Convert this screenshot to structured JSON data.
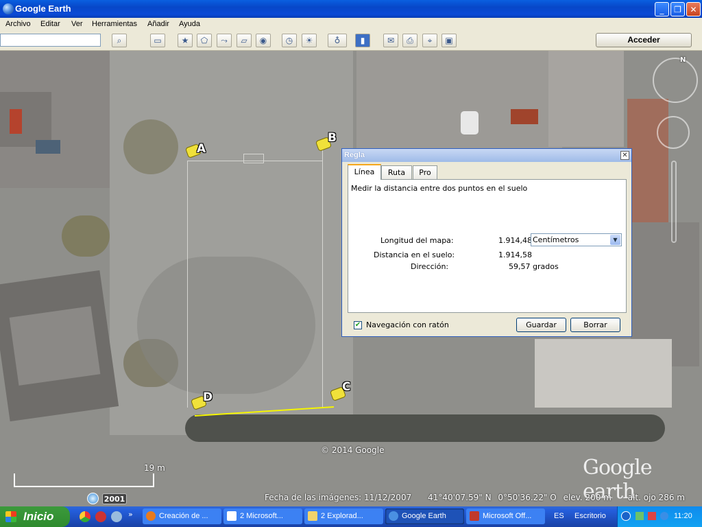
{
  "window": {
    "title": "Google Earth"
  },
  "menu": [
    "Archivo",
    "Editar",
    "Ver",
    "Herramientas",
    "Añadir",
    "Ayuda"
  ],
  "toolbar": {
    "search_value": "",
    "icons": [
      "search-icon",
      "sidebar-icon",
      "placemark-icon",
      "polygon-icon",
      "path-icon",
      "overlay-icon",
      "record-tour-icon",
      "historical-imagery-icon",
      "sunlight-icon",
      "planets-icon",
      "ruler-icon",
      "email-icon",
      "print-icon",
      "show-in-maps-icon",
      "save-image-icon"
    ],
    "signin_label": "Acceder"
  },
  "map": {
    "placemarks": [
      "A",
      "B",
      "C",
      "D"
    ],
    "copyright": "© 2014 Google",
    "logo": "Google earth",
    "scale_label": "19 m",
    "year": "2001",
    "status": {
      "image_date": "Fecha de las imágenes: 11/12/2007",
      "lat": "41°40'07.59\" N",
      "lon": "0°50'36.22\" O",
      "elev": "elev.  200 m",
      "eye_alt": "alt. ojo   286 m"
    },
    "compass_north": "N"
  },
  "ruler_dialog": {
    "title": "Regla",
    "tabs": [
      "Línea",
      "Ruta",
      "Pro"
    ],
    "description": "Medir la distancia entre dos puntos en el suelo",
    "map_length_label": "Longitud del mapa:",
    "map_length_value": "1.914,48",
    "units_selected": "Centímetros",
    "ground_distance_label": "Distancia en el suelo:",
    "ground_distance_value": "1.914,58",
    "heading_label": "Dirección:",
    "heading_value": "59,57 grados",
    "mouse_nav_label": "Navegación con ratón",
    "mouse_nav_checked": true,
    "save_label": "Guardar",
    "clear_label": "Borrar"
  },
  "taskbar": {
    "start_label": "Inicio",
    "tasks": [
      {
        "label": "Creación de ...",
        "color": "#e87a1e"
      },
      {
        "label": "2 Microsoft...",
        "color": "#ffffff"
      },
      {
        "label": "2 Explorad...",
        "color": "#f3d36b"
      },
      {
        "label": "Google Earth",
        "color": "#4a90e2"
      },
      {
        "label": "Microsoft Off...",
        "color": "#c0392b"
      }
    ],
    "language": "ES",
    "desktop_label": "Escritorio",
    "clock": "11:20"
  }
}
